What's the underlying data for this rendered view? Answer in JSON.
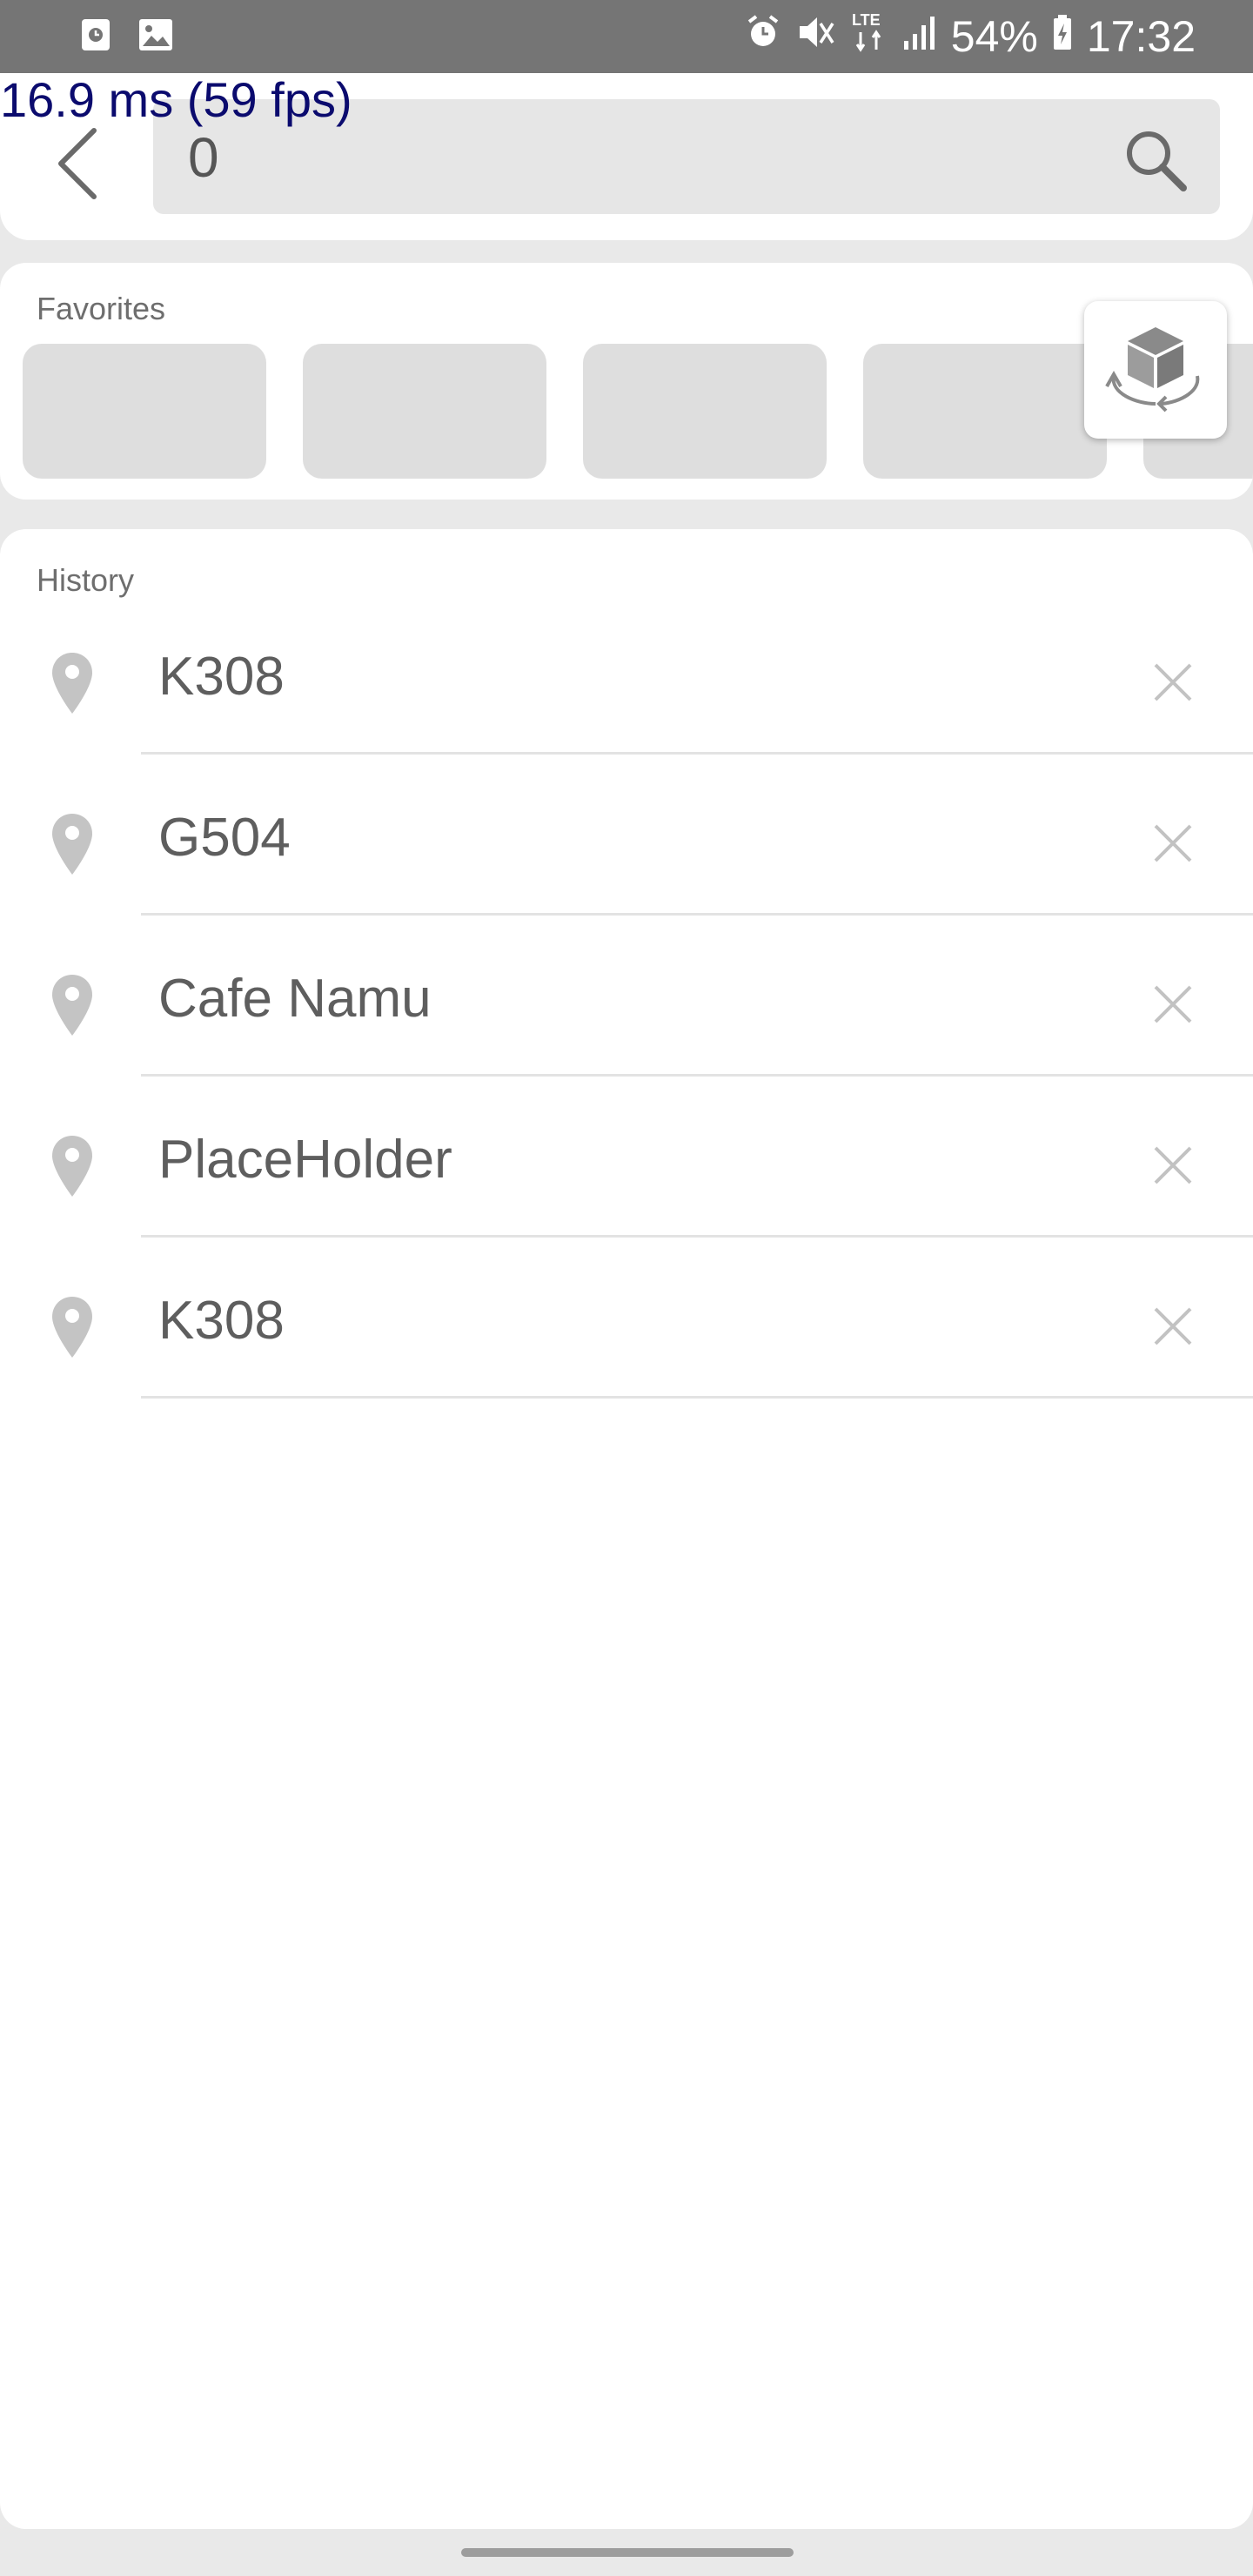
{
  "status_bar": {
    "battery": "54%",
    "time": "17:32",
    "network": "LTE",
    "icons": [
      "screenshot-icon",
      "gallery-icon",
      "alarm-icon",
      "mute-icon",
      "lte-icon",
      "signal-icon",
      "battery-charging-icon"
    ]
  },
  "debug": {
    "fps_text": "16.9 ms (59 fps)"
  },
  "search": {
    "value": "0",
    "icon": "search-icon"
  },
  "favorites": {
    "label": "Favorites",
    "tile_count": 5
  },
  "history": {
    "label": "History",
    "items": [
      {
        "label": "K308"
      },
      {
        "label": "G504"
      },
      {
        "label": "Cafe Namu"
      },
      {
        "label": "PlaceHolder"
      },
      {
        "label": "K308"
      }
    ]
  },
  "colors": {
    "status_bar": "#757575",
    "background": "#e9e9e9",
    "card": "#ffffff",
    "tile": "#dedede",
    "text": "#5e5e5e",
    "fps": "#0b0b6e"
  }
}
